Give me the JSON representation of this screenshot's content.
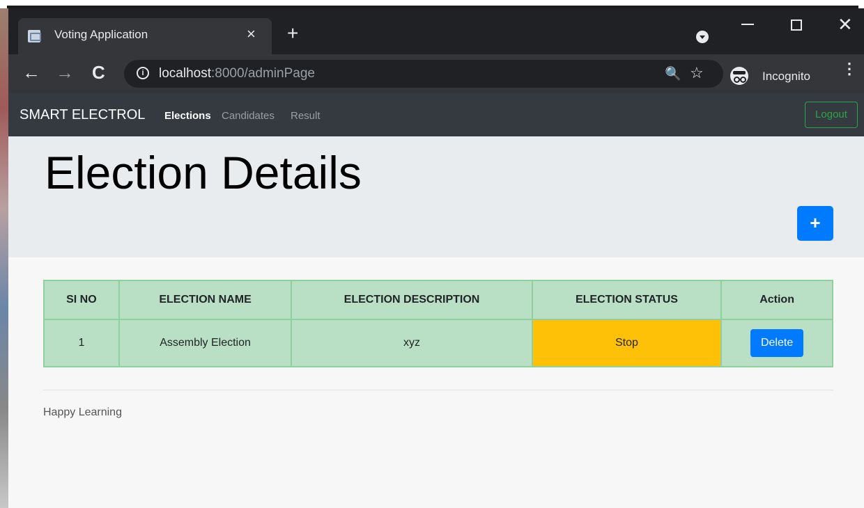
{
  "browser": {
    "tab_title": "Voting Application",
    "tab_close": "×",
    "new_tab": "+",
    "url_host": "localhost",
    "url_path": ":8000/adminPage",
    "profile_label": "Incognito",
    "menu_glyph": "⋮",
    "window_close": "✕",
    "info_glyph": "i",
    "zoom_glyph": "🔍",
    "star_glyph": "☆",
    "back_glyph": "←",
    "forward_glyph": "→",
    "reload_glyph": "C"
  },
  "navbar": {
    "brand": "SMART ELECTROL",
    "links": [
      "Elections",
      "Candidates",
      "Result"
    ],
    "logout_label": "Logout",
    "logout_color": "#28a745"
  },
  "jumbotron": {
    "title": "Election Details",
    "add_button_label": "+",
    "add_button_color": "#007bff"
  },
  "table": {
    "headers": [
      "SI NO",
      "ELECTION NAME",
      "ELECTION DESCRIPTION",
      "ELECTION STATUS",
      "Action"
    ],
    "rows": [
      {
        "si_no": "1",
        "name": "Assembly Election",
        "description": "xyz",
        "status": "Stop",
        "action_label": "Delete"
      }
    ],
    "row_color": "#b9dfc4",
    "status_color": "#ffc107"
  },
  "footer": {
    "text": "Happy Learning"
  },
  "icons": [
    "favicon-icon",
    "close-icon",
    "plus-icon",
    "profile-icon",
    "back-icon",
    "forward-icon",
    "reload-icon",
    "info-icon",
    "zoom-icon",
    "star-icon",
    "incognito-icon",
    "kebab-menu-icon"
  ]
}
